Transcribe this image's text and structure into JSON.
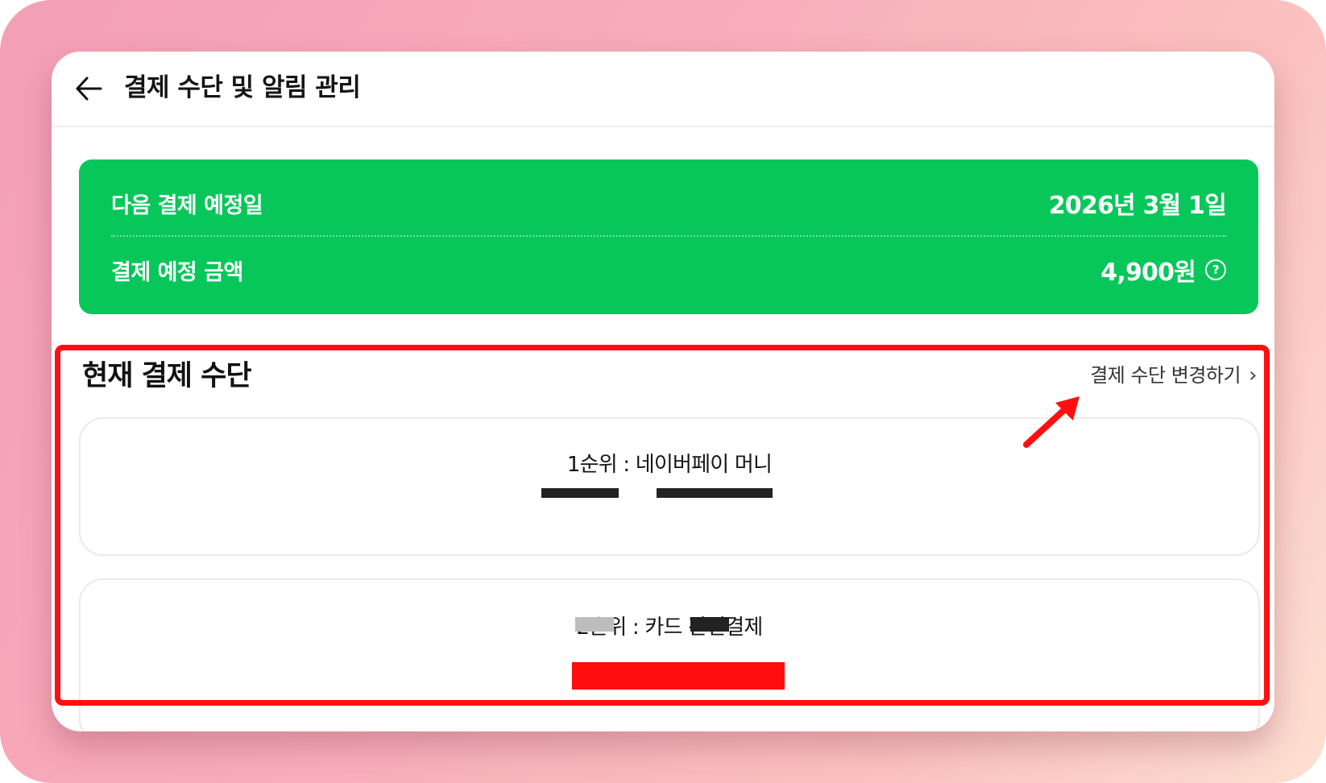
{
  "header": {
    "title": "결제 수단 및 알림 관리"
  },
  "summary": {
    "next_date_label": "다음 결제 예정일",
    "next_date_value": "2026년 3월 1일",
    "amount_label": "결제 예정 금액",
    "amount_value": "4,900원",
    "help_glyph": "?"
  },
  "payment_section": {
    "title": "현재 결제 수단",
    "change_link": "결제 수단 변경하기",
    "chevron": "›",
    "methods": [
      {
        "label": "1순위 : 네이버페이 머니"
      },
      {
        "label": "2순위 : 카드 간편결제"
      }
    ]
  },
  "colors": {
    "summary_bg": "#07c75a",
    "annotation": "#ff1010"
  }
}
